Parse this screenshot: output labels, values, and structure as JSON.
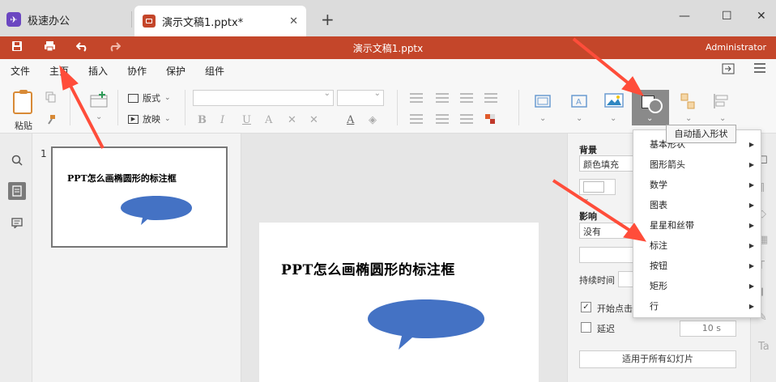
{
  "tabs": {
    "app_label": "极速办公",
    "doc_label": "演示文稿1.pptx*",
    "close": "✕",
    "new_tab": "+",
    "minimize": "—",
    "maximize": "☐",
    "close_window": "✕"
  },
  "titlebar": {
    "title": "演示文稿1.pptx",
    "user": "Administrator"
  },
  "menu": [
    "文件",
    "主页",
    "插入",
    "协作",
    "保护",
    "组件"
  ],
  "ribbon": {
    "paste_label": "粘贴",
    "layout_label": "版式",
    "slideshow_label": "放映",
    "format_buttons": [
      "B",
      "I",
      "U",
      "A",
      "✕",
      "✕"
    ]
  },
  "thumbnails": {
    "slide_number": "1",
    "slide_title": "PPT怎么画椭圆形的标注框"
  },
  "slide": {
    "title": "PPT怎么画椭圆形的标注框",
    "callout_color": "#4472c4"
  },
  "right_panel": {
    "background_label": "背景",
    "fill_value": "颜色填充",
    "effect_label": "影响",
    "effect_value": "没有",
    "duration_label": "持续时间",
    "start_on_click": "开始点击",
    "delay_label": "延迟",
    "delay_value": "10 s",
    "apply_all": "适用于所有幻灯片"
  },
  "tooltip": "自动插入形状",
  "shape_menu": [
    {
      "label": "基本形状"
    },
    {
      "label": "图形箭头"
    },
    {
      "label": "数学"
    },
    {
      "label": "图表"
    },
    {
      "label": "星星和丝带"
    },
    {
      "label": "标注"
    },
    {
      "label": "按钮"
    },
    {
      "label": "矩形"
    },
    {
      "label": "行"
    }
  ],
  "colors": {
    "brand": "#c4462a",
    "annotation_arrow": "#ff4d3a"
  }
}
